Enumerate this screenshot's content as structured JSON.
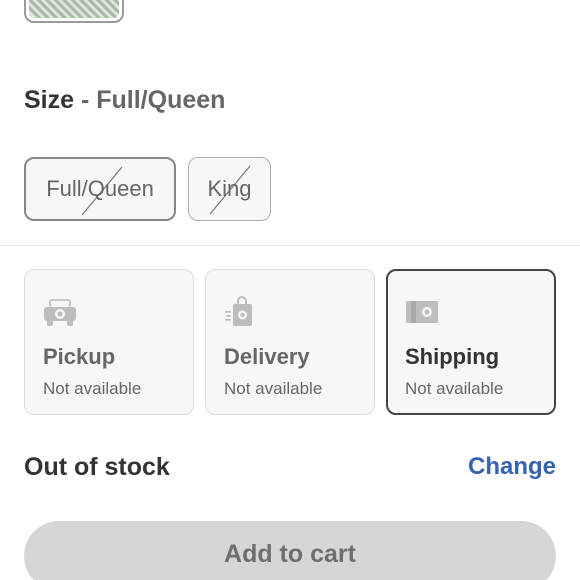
{
  "size": {
    "heading_label": "Size",
    "separator": " - ",
    "selected_value": "Full/Queen",
    "options": [
      {
        "label": "Full/Queen",
        "selected": true,
        "unavailable": true
      },
      {
        "label": "King",
        "selected": false,
        "unavailable": true
      }
    ]
  },
  "fulfillment": {
    "options": [
      {
        "title": "Pickup",
        "status": "Not available",
        "icon": "car-icon",
        "selected": false
      },
      {
        "title": "Delivery",
        "status": "Not available",
        "icon": "shopping-bag-icon",
        "selected": false
      },
      {
        "title": "Shipping",
        "status": "Not available",
        "icon": "shipping-box-icon",
        "selected": true
      }
    ]
  },
  "stock": {
    "status": "Out of stock",
    "change_label": "Change"
  },
  "cart": {
    "button_label": "Add to cart",
    "disabled": true
  },
  "colors": {
    "link": "#3563b4",
    "disabled_button": "#d6d6d6",
    "icon_gray": "#bdbdbd"
  }
}
